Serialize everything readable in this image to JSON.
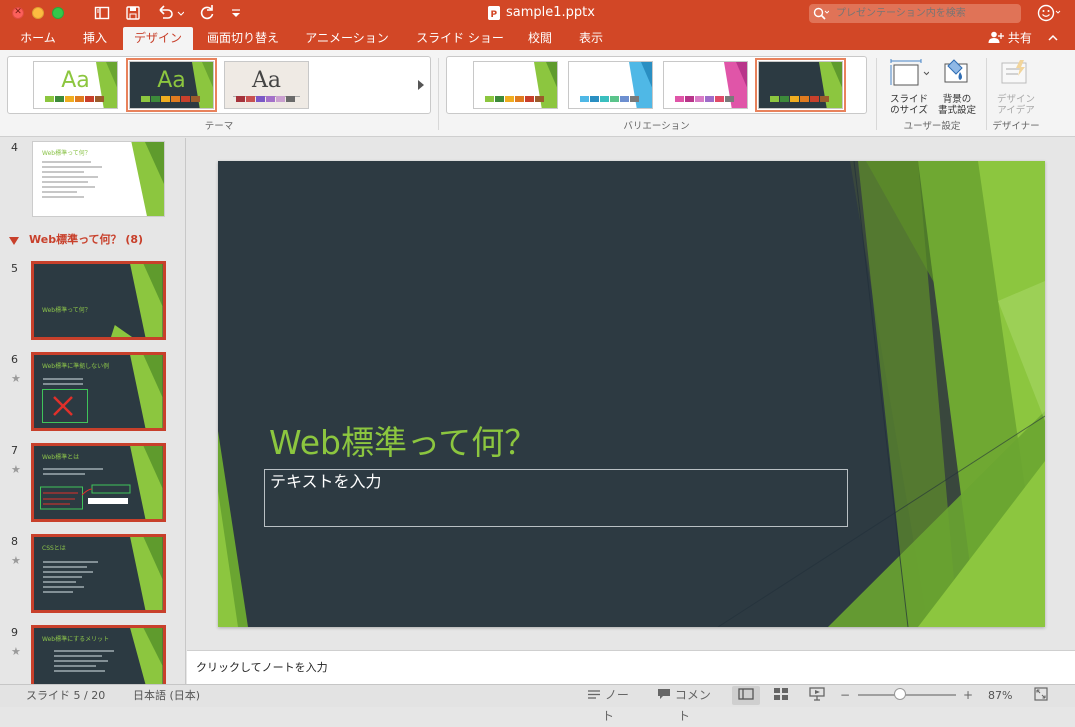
{
  "titlebar": {
    "document_title": "sample1.pptx",
    "search_placeholder": "プレゼンテーション内を検索",
    "icons": [
      "sidebar-icon",
      "save-icon",
      "undo-icon",
      "redo-icon",
      "customize-icon",
      "search-icon",
      "smiley-icon"
    ]
  },
  "tabs": [
    {
      "label": "ホーム"
    },
    {
      "label": "挿入"
    },
    {
      "label": "デザイン",
      "active": true
    },
    {
      "label": "画面切り替え"
    },
    {
      "label": "アニメーション"
    },
    {
      "label": "スライド ショー"
    },
    {
      "label": "校閲"
    },
    {
      "label": "表示"
    }
  ],
  "share_label": "共有",
  "ribbon": {
    "themes_group_label": "テーマ",
    "variations_group_label": "バリエーション",
    "user_settings_group_label": "ユーザー設定",
    "designer_group_label": "デザイナー",
    "theme_sample_text": "Aa",
    "slide_size_label": [
      "スライド",
      "のサイズ"
    ],
    "format_background_label": [
      "背景の",
      "書式設定"
    ],
    "design_ideas_label": [
      "デザイン",
      "アイデア"
    ]
  },
  "colors": {
    "accent": "#d24726",
    "slide_background": "#2d3a42",
    "slide_title_color": "#8cc63f"
  },
  "thumbnails": {
    "section_title": "Web標準って何？ (8)",
    "slides": [
      {
        "number": "4",
        "title": "Web標準って何？",
        "starred": false
      },
      {
        "number": "5",
        "title": "Web標準って何？",
        "starred": false,
        "selected": true
      },
      {
        "number": "6",
        "title": "Web標準に準拠しない例",
        "starred": true
      },
      {
        "number": "7",
        "title": "Web標準とは",
        "starred": true
      },
      {
        "number": "8",
        "title": "CSSとは",
        "starred": true
      },
      {
        "number": "9",
        "title": "Web標準にするメリット",
        "starred": true
      }
    ]
  },
  "slide": {
    "title": "Web標準って何？",
    "subtitle_placeholder": "テキストを入力"
  },
  "notes_placeholder": "クリックしてノートを入力",
  "status": {
    "slide_position": "スライド 5 / 20",
    "language": "日本語 (日本)",
    "notes_label": "ノート",
    "comments_label": "コメント",
    "zoom_percent": "87%",
    "zoom_level": 0.43
  }
}
